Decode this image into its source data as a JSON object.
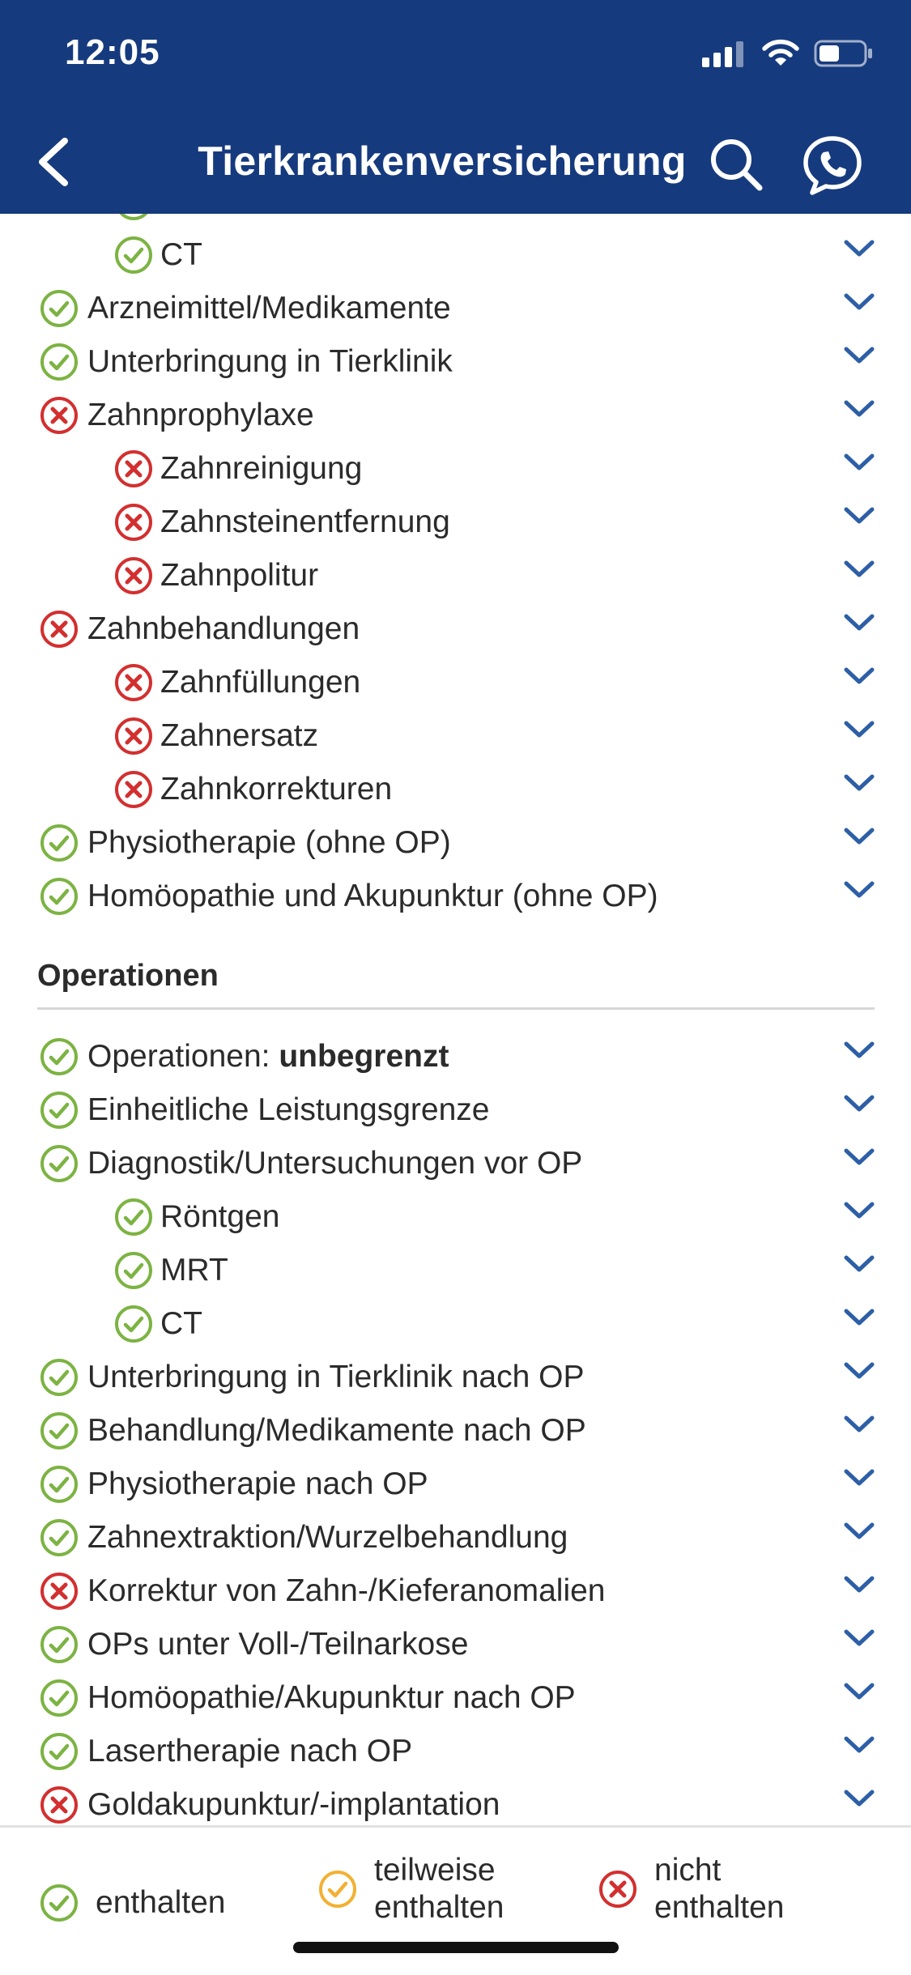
{
  "status_bar": {
    "time": "12:05"
  },
  "nav": {
    "title": "Tierkrankenversicherung"
  },
  "colors": {
    "header": "#163a7e",
    "included": "#7cb342",
    "partial": "#f2b134",
    "excluded": "#d32f2f",
    "chevron": "#2d5fa6"
  },
  "list_top": [
    {
      "label": "CT",
      "status": "included",
      "level": 1
    },
    {
      "label": "Arzneimittel/Medikamente",
      "status": "included",
      "level": 0
    },
    {
      "label": "Unterbringung in Tierklinik",
      "status": "included",
      "level": 0
    },
    {
      "label": "Zahnprophylaxe",
      "status": "excluded",
      "level": 0
    },
    {
      "label": "Zahnreinigung",
      "status": "excluded",
      "level": 1
    },
    {
      "label": "Zahnsteinentfernung",
      "status": "excluded",
      "level": 1
    },
    {
      "label": "Zahnpolitur",
      "status": "excluded",
      "level": 1
    },
    {
      "label": "Zahnbehandlungen",
      "status": "excluded",
      "level": 0
    },
    {
      "label": "Zahnfüllungen",
      "status": "excluded",
      "level": 1
    },
    {
      "label": "Zahnersatz",
      "status": "excluded",
      "level": 1
    },
    {
      "label": "Zahnkorrekturen",
      "status": "excluded",
      "level": 1
    },
    {
      "label": "Physiotherapie (ohne OP)",
      "status": "included",
      "level": 0
    },
    {
      "label": "Homöopathie und Akupunktur (ohne OP)",
      "status": "included",
      "level": 0
    }
  ],
  "section": {
    "title": "Operationen",
    "first_item": {
      "label": "Operationen: ",
      "value": "unbegrenzt",
      "status": "included"
    }
  },
  "list_ops": [
    {
      "label": "Einheitliche Leistungsgrenze",
      "status": "included",
      "level": 0
    },
    {
      "label": "Diagnostik/Untersuchungen vor OP",
      "status": "included",
      "level": 0
    },
    {
      "label": "Röntgen",
      "status": "included",
      "level": 1
    },
    {
      "label": "MRT",
      "status": "included",
      "level": 1
    },
    {
      "label": "CT",
      "status": "included",
      "level": 1
    },
    {
      "label": "Unterbringung in Tierklinik nach OP",
      "status": "included",
      "level": 0
    },
    {
      "label": "Behandlung/Medikamente nach OP",
      "status": "included",
      "level": 0
    },
    {
      "label": "Physiotherapie nach OP",
      "status": "included",
      "level": 0
    },
    {
      "label": "Zahnextraktion/Wurzelbehandlung",
      "status": "included",
      "level": 0
    },
    {
      "label": "Korrektur von Zahn-/Kieferanomalien",
      "status": "excluded",
      "level": 0
    },
    {
      "label": "OPs unter Voll-/Teilnarkose",
      "status": "included",
      "level": 0
    },
    {
      "label": "Homöopathie/Akupunktur nach OP",
      "status": "included",
      "level": 0
    },
    {
      "label": "Lasertherapie nach OP",
      "status": "included",
      "level": 0
    },
    {
      "label": "Goldakupunktur/-implantation",
      "status": "excluded",
      "level": 0
    }
  ],
  "legend": {
    "included": "enthalten",
    "partial_line1": "teilweise",
    "partial_line2": "enthalten",
    "excluded_line1": "nicht",
    "excluded_line2": "enthalten"
  }
}
